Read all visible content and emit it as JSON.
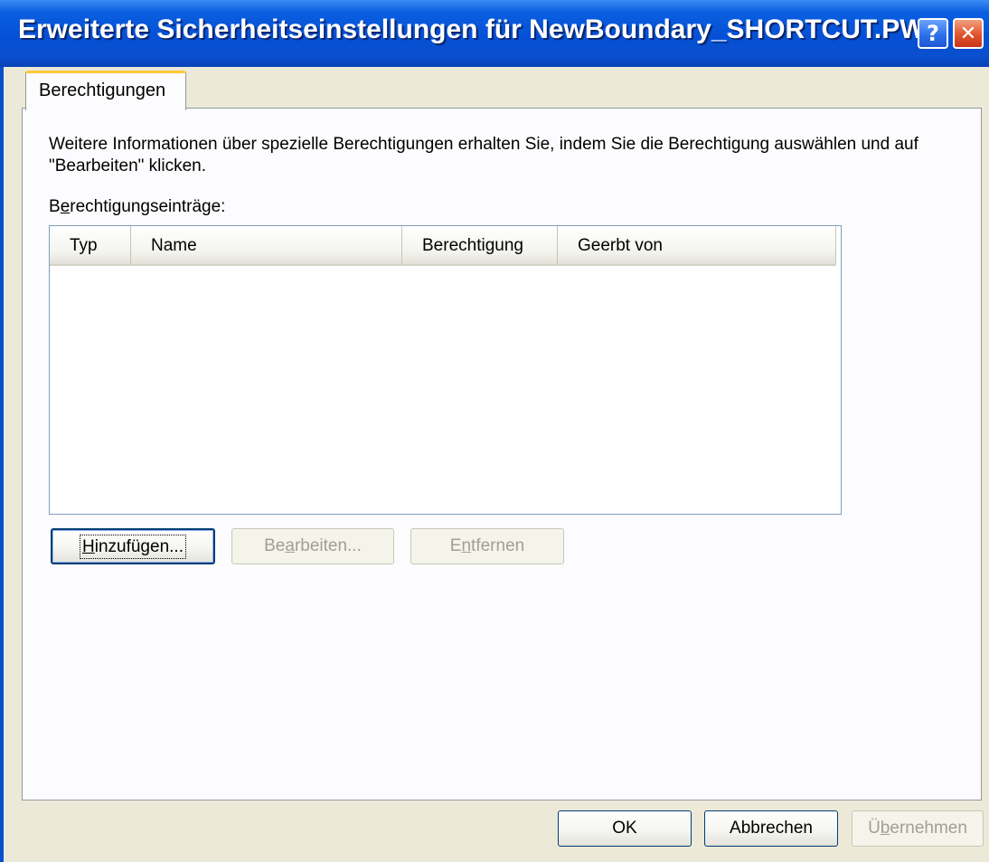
{
  "window": {
    "title": "Erweiterte Sicherheitseinstellungen für NewBoundary_SHORTCUT.PWC",
    "help_glyph": "?",
    "close_glyph": "✕"
  },
  "tabs": [
    {
      "label": "Berechtigungen",
      "active": true
    }
  ],
  "panel": {
    "info_text": "Weitere Informationen über spezielle Berechtigungen erhalten Sie, indem Sie die Berechtigung auswählen und auf \"Bearbeiten\" klicken.",
    "entries_label_pre": "B",
    "entries_label_u": "e",
    "entries_label_post": "rechtigungseinträge:",
    "columns": [
      "Typ",
      "Name",
      "Berechtigung",
      "Geerbt von"
    ],
    "rows": []
  },
  "entry_buttons": {
    "add": {
      "pre": "",
      "u": "H",
      "post": "inzufügen...",
      "enabled": true
    },
    "edit": {
      "pre": "Be",
      "u": "a",
      "post": "rbeiten...",
      "enabled": false
    },
    "remove": {
      "pre": "E",
      "u": "n",
      "post": "tfernen",
      "enabled": false
    }
  },
  "dialog_buttons": {
    "ok": "OK",
    "cancel": "Abbrechen",
    "apply": {
      "pre": "Ü",
      "u": "b",
      "post": "ernehmen",
      "enabled": false
    }
  },
  "colors": {
    "titlebar": "#0550d6",
    "tab_highlight": "#ffc83c",
    "dialog_bg": "#ece9d8"
  }
}
